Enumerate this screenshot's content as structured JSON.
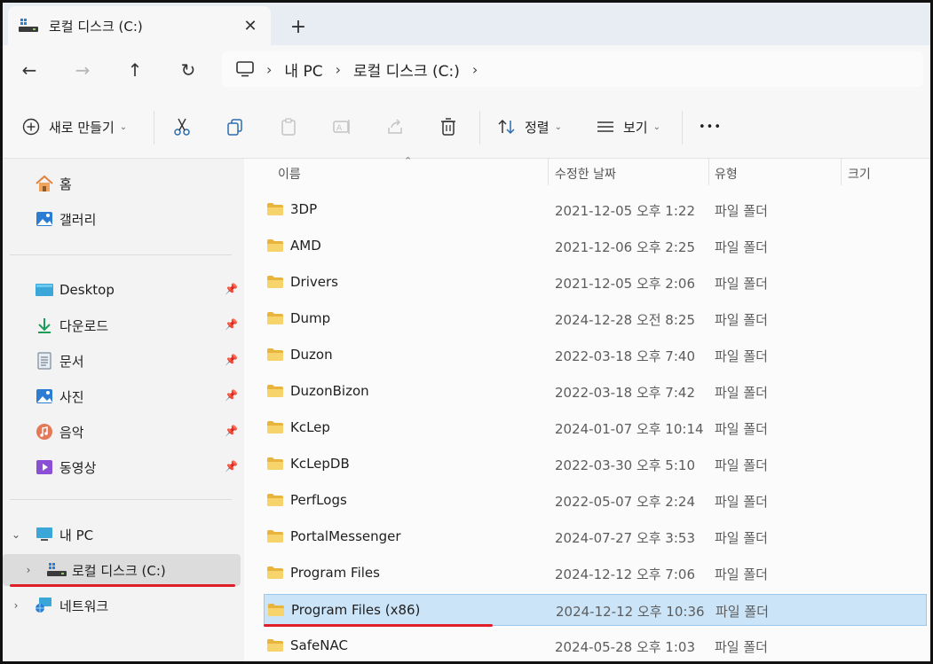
{
  "tab": {
    "title": "로컬 디스크 (C:)",
    "close": "✕",
    "new": "+"
  },
  "nav": {
    "back": "←",
    "forward": "→",
    "up": "↑",
    "refresh": "↻",
    "breadcrumb": [
      "내 PC",
      "로컬 디스크 (C:)"
    ],
    "sep": "›"
  },
  "toolbar": {
    "new_label": "새로 만들기",
    "sort_label": "정렬",
    "view_label": "보기",
    "more": "•••"
  },
  "sidebar": {
    "home": "홈",
    "gallery": "갤러리",
    "quick": [
      "Desktop",
      "다운로드",
      "문서",
      "사진",
      "음악",
      "동영상"
    ],
    "mypc": "내 PC",
    "localdisk": "로컬 디스크 (C:)",
    "network": "네트워크"
  },
  "columns": {
    "name": "이름",
    "date": "수정한 날짜",
    "type": "유형",
    "size": "크기"
  },
  "files": [
    {
      "name": "3DP",
      "date": "2021-12-05 오후 1:22",
      "type": "파일 폴더"
    },
    {
      "name": "AMD",
      "date": "2021-12-06 오후 2:25",
      "type": "파일 폴더"
    },
    {
      "name": "Drivers",
      "date": "2021-12-05 오후 2:06",
      "type": "파일 폴더"
    },
    {
      "name": "Dump",
      "date": "2024-12-28 오전 8:25",
      "type": "파일 폴더"
    },
    {
      "name": "Duzon",
      "date": "2022-03-18 오후 7:40",
      "type": "파일 폴더"
    },
    {
      "name": "DuzonBizon",
      "date": "2022-03-18 오후 7:42",
      "type": "파일 폴더"
    },
    {
      "name": "KcLep",
      "date": "2024-01-07 오후 10:14",
      "type": "파일 폴더"
    },
    {
      "name": "KcLepDB",
      "date": "2022-03-30 오후 5:10",
      "type": "파일 폴더"
    },
    {
      "name": "PerfLogs",
      "date": "2022-05-07 오후 2:24",
      "type": "파일 폴더"
    },
    {
      "name": "PortalMessenger",
      "date": "2024-07-27 오후 3:53",
      "type": "파일 폴더"
    },
    {
      "name": "Program Files",
      "date": "2024-12-12 오후 7:06",
      "type": "파일 폴더"
    },
    {
      "name": "Program Files (x86)",
      "date": "2024-12-12 오후 10:36",
      "type": "파일 폴더"
    },
    {
      "name": "SafeNAC",
      "date": "2024-05-28 오후 1:03",
      "type": "파일 폴더"
    }
  ],
  "colors": {
    "selection": "#cce4f7",
    "highlight_line": "#e01e2a",
    "folder": "#f4c64a"
  }
}
